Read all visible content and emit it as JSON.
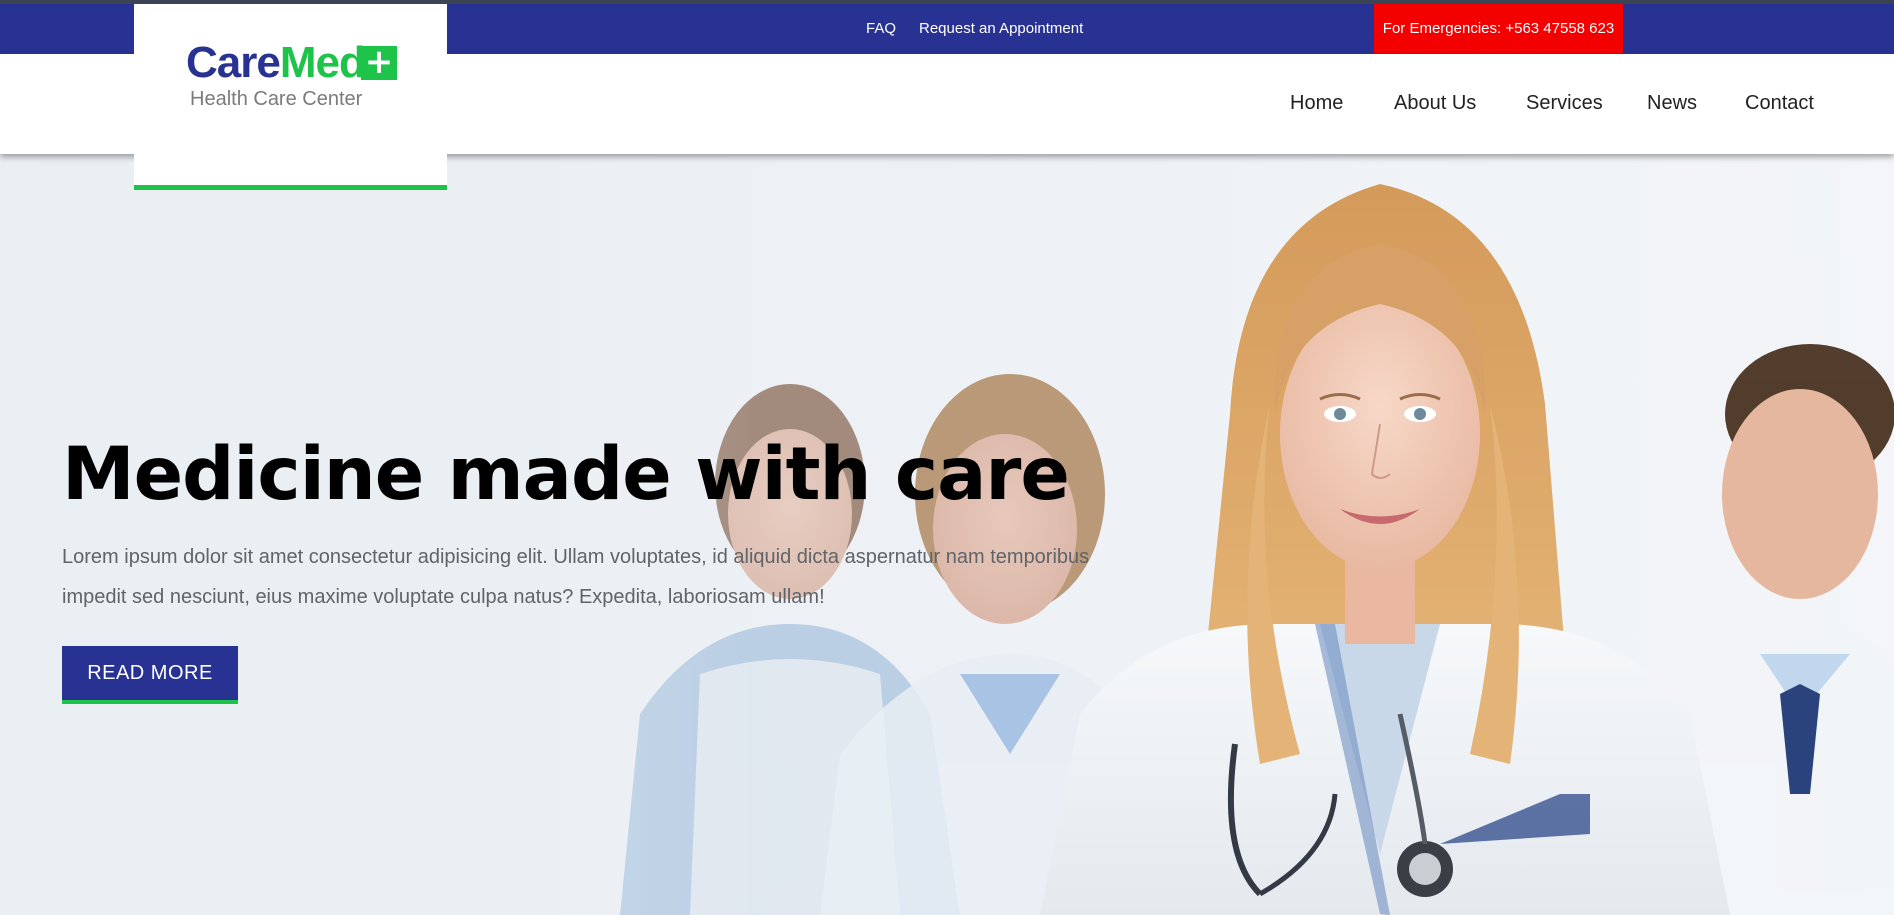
{
  "topbar": {
    "faq_label": "FAQ",
    "appointment_label": "Request an Appointment",
    "emergency_label": "For Emergencies: +563 47558 623"
  },
  "logo": {
    "word_care": "Care",
    "word_med": "Med",
    "plus_glyph": "+",
    "tagline": "Health Care Center"
  },
  "nav": {
    "items": [
      {
        "label": "Home"
      },
      {
        "label": "About Us"
      },
      {
        "label": "Services"
      },
      {
        "label": "News"
      },
      {
        "label": "Contact"
      }
    ]
  },
  "hero": {
    "title": "Medicine made with care",
    "text": "Lorem ipsum dolor sit amet consectetur adipisicing elit. Ullam voluptates, id aliquid dicta aspernatur nam temporibus impedit sed nesciunt, eius maxime voluptate culpa natus? Expedita, laboriosam ullam!",
    "button_label": "READ MORE"
  },
  "colors": {
    "brand_blue": "#283292",
    "brand_green": "#1ec44a",
    "emergency_red": "#f40000"
  }
}
